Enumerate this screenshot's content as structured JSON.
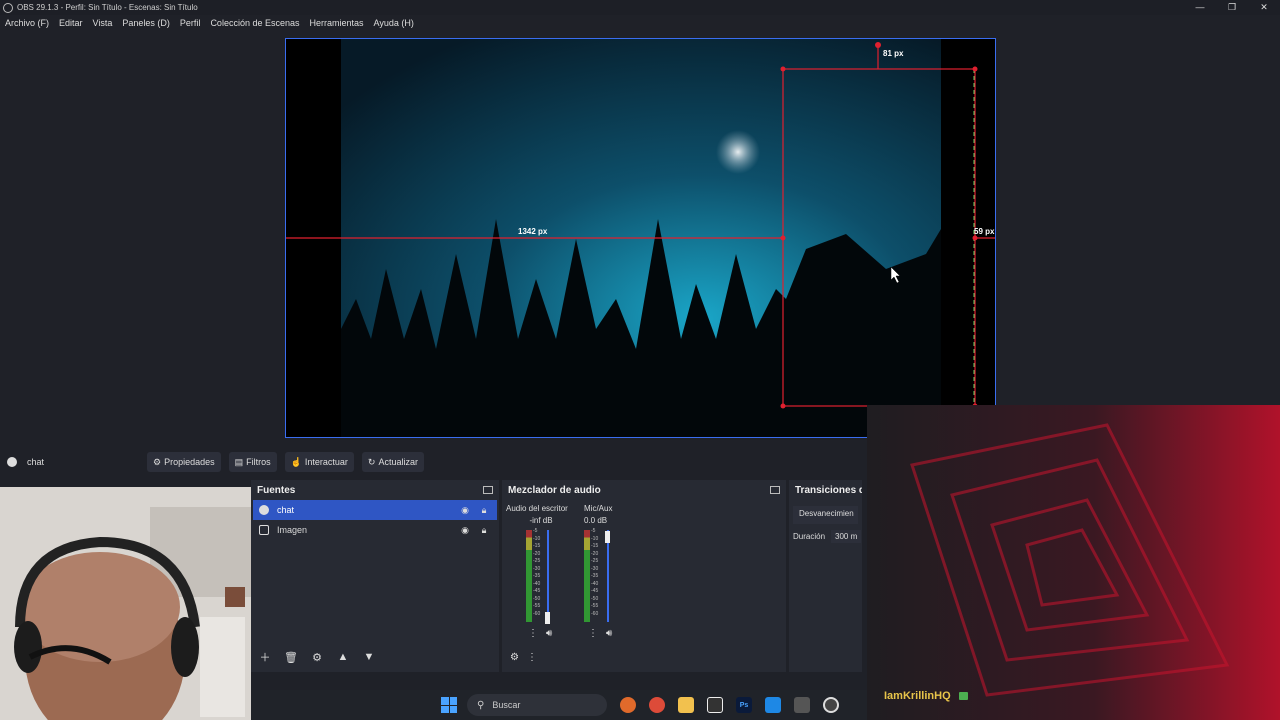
{
  "window": {
    "title": "OBS 29.1.3 - Perfil: Sin Título - Escenas: Sin Título",
    "controls": [
      "—",
      "❐",
      "✕"
    ]
  },
  "menu": [
    "Archivo (F)",
    "Editar",
    "Vista",
    "Paneles (D)",
    "Perfil",
    "Colección de Escenas",
    "Herramientas",
    "Ayuda (H)"
  ],
  "preview": {
    "measure_top": "81 px",
    "measure_left": "1342 px",
    "measure_right": "59 px"
  },
  "source_toolbar": {
    "selected_source": "chat",
    "properties": "Propiedades",
    "filters": "Filtros",
    "interact": "Interactuar",
    "refresh": "Actualizar"
  },
  "sources_dock": {
    "title": "Fuentes",
    "items": [
      {
        "name": "chat",
        "selected": true,
        "icon": "globe-icon"
      },
      {
        "name": "Imagen",
        "selected": false,
        "icon": "image-icon"
      }
    ],
    "footer_icons": [
      "add-icon",
      "trash-icon",
      "gear-icon",
      "up-icon",
      "down-icon"
    ]
  },
  "mixer_dock": {
    "title": "Mezclador de audio",
    "channels": [
      {
        "name": "Audio del escritor",
        "level": "-inf dB"
      },
      {
        "name": "Mic/Aux",
        "level": "0.0 dB"
      }
    ],
    "ticks": [
      "-5",
      "-10",
      "-15",
      "-20",
      "-25",
      "-30",
      "-35",
      "-40",
      "-45",
      "-50",
      "-55",
      "-60"
    ]
  },
  "transitions_dock": {
    "title": "Transiciones d",
    "selected": "Desvanecimien",
    "duration_label": "Duración",
    "duration_value": "300 m"
  },
  "overlay": {
    "username": "IamKrillinHQ"
  },
  "taskbar": {
    "search_placeholder": "Buscar"
  },
  "colors": {
    "accent": "#3a6df0",
    "crop_red": "#e0202f",
    "username": "#e8c44a"
  }
}
